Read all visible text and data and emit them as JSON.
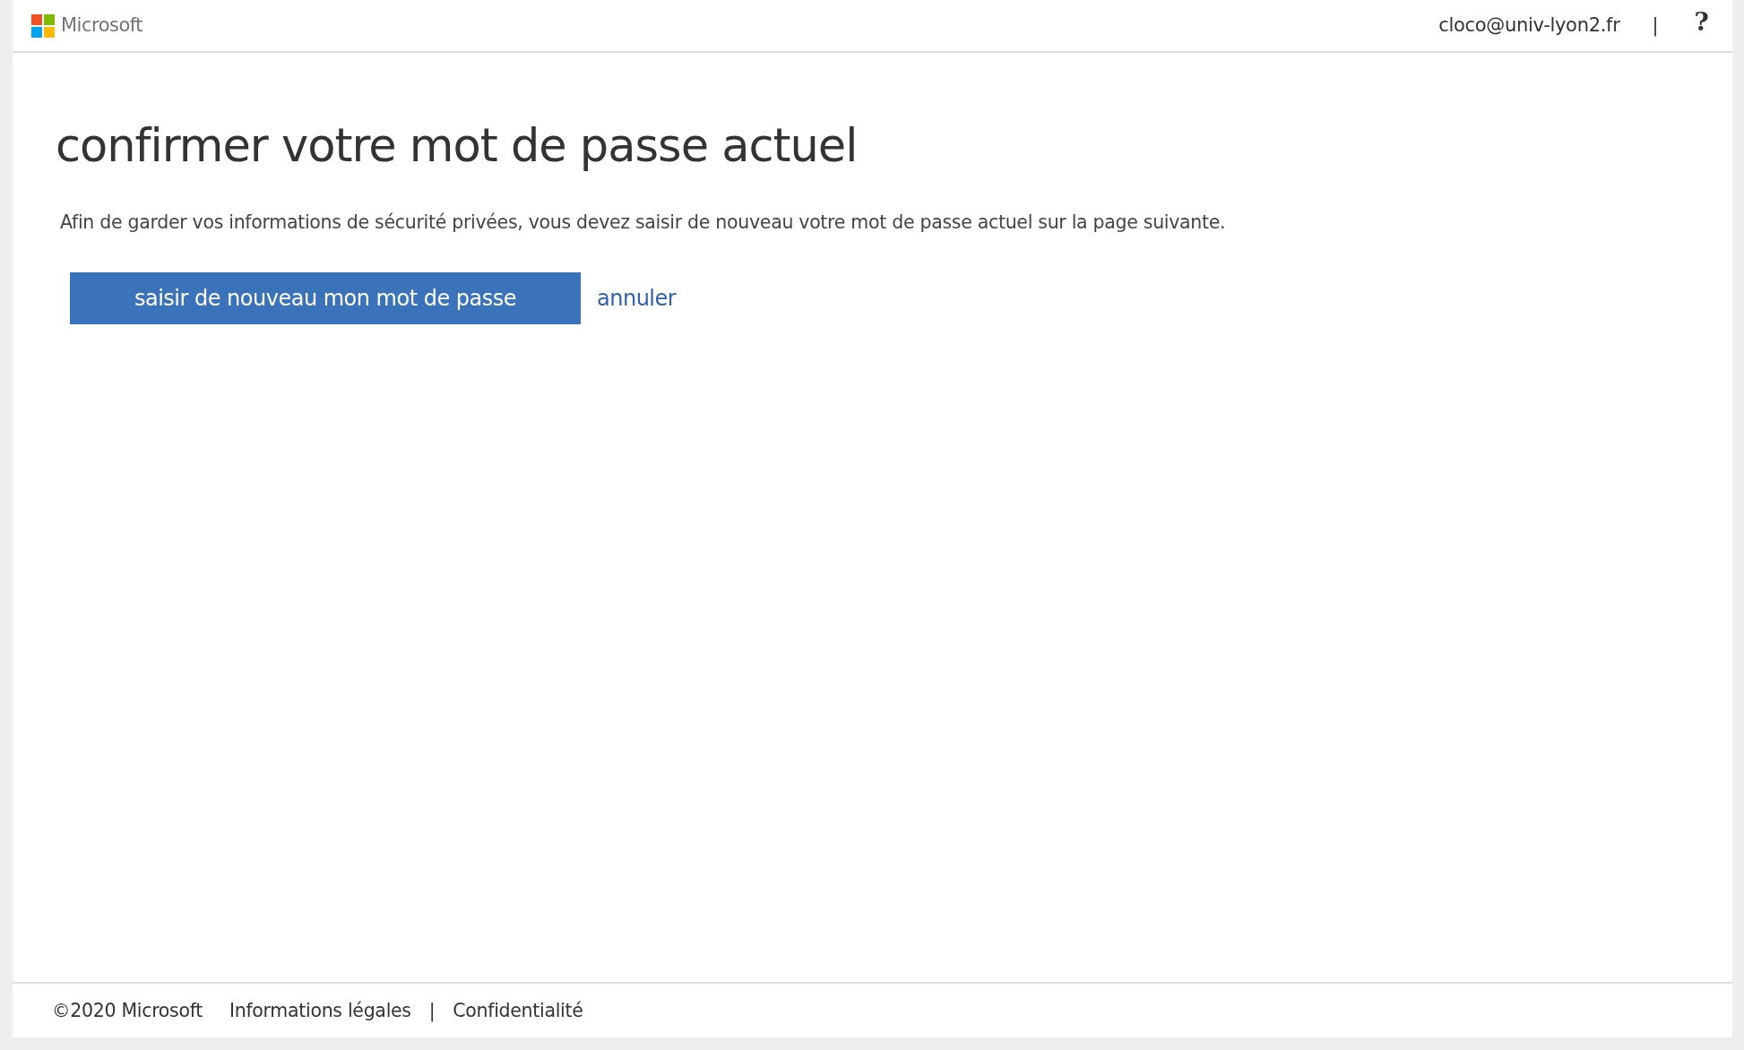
{
  "header": {
    "logo_text": "Microsoft",
    "account": "cloco@univ-lyon2.fr",
    "separator": "|",
    "help": "?"
  },
  "title": "confirmer votre mot de passe actuel",
  "description": "Afin de garder vos informations de sécurité privées, vous devez saisir de nouveau votre mot de passe actuel sur la page suivante.",
  "primary_button": "saisir de nouveau mon mot de passe",
  "cancel_link": "annuler",
  "footer": {
    "copyright": "©2020 Microsoft",
    "links": [
      {
        "label": "Informations légales"
      },
      {
        "label": "Confidentialité"
      }
    ],
    "separator": "|"
  }
}
